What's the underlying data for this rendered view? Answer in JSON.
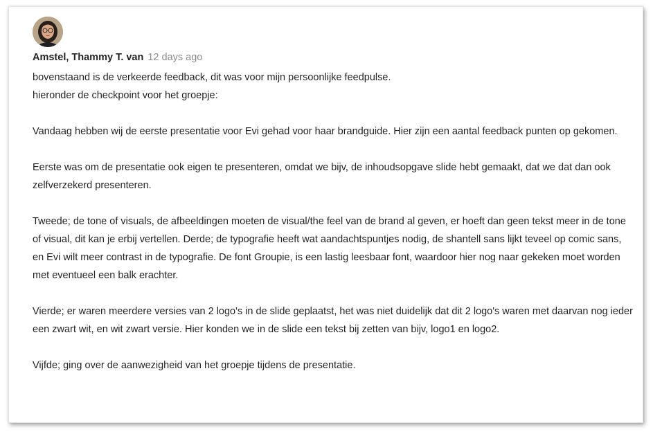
{
  "comment": {
    "author": "Amstel, Thammy T. van",
    "timestamp": "12 days ago",
    "avatar_icon": "user-avatar-photo",
    "paragraphs": [
      "bovenstaand is de verkeerde feedback, dit was voor mijn persoonlijke feedpulse.",
      "hieronder de checkpoint voor het groepje:",
      "Vandaag hebben wij de eerste presentatie voor Evi gehad voor haar brandguide. Hier zijn een aantal feedback punten op gekomen.",
      "Eerste was om de presentatie ook eigen te presenteren, omdat we bijv, de inhoudsopgave slide hebt gemaakt, dat we dat dan ook zelfverzekerd presenteren.",
      "Tweede; de tone of visuals, de afbeeldingen moeten de visual/the feel van de brand al geven, er hoeft dan geen tekst meer in de tone of visual, dit kan je erbij vertellen.  Derde; de typografie heeft wat aandachtspuntjes nodig, de shantell sans lijkt teveel op comic sans, en Evi wilt meer contrast in de typografie. De font Groupie, is een lastig leesbaar font, waardoor hier nog naar gekeken moet worden met eventueel een balk erachter.",
      "Vierde; er waren meerdere versies van 2 logo's in de slide geplaatst, het was niet duidelijk dat dit 2 logo's waren met daarvan nog ieder een zwart wit, en wit zwart versie. Hier konden we in de slide een tekst bij zetten van bijv, logo1 en logo2.",
      "Vijfde; ging over de aanwezigheid van het groepje tijdens de presentatie."
    ]
  }
}
